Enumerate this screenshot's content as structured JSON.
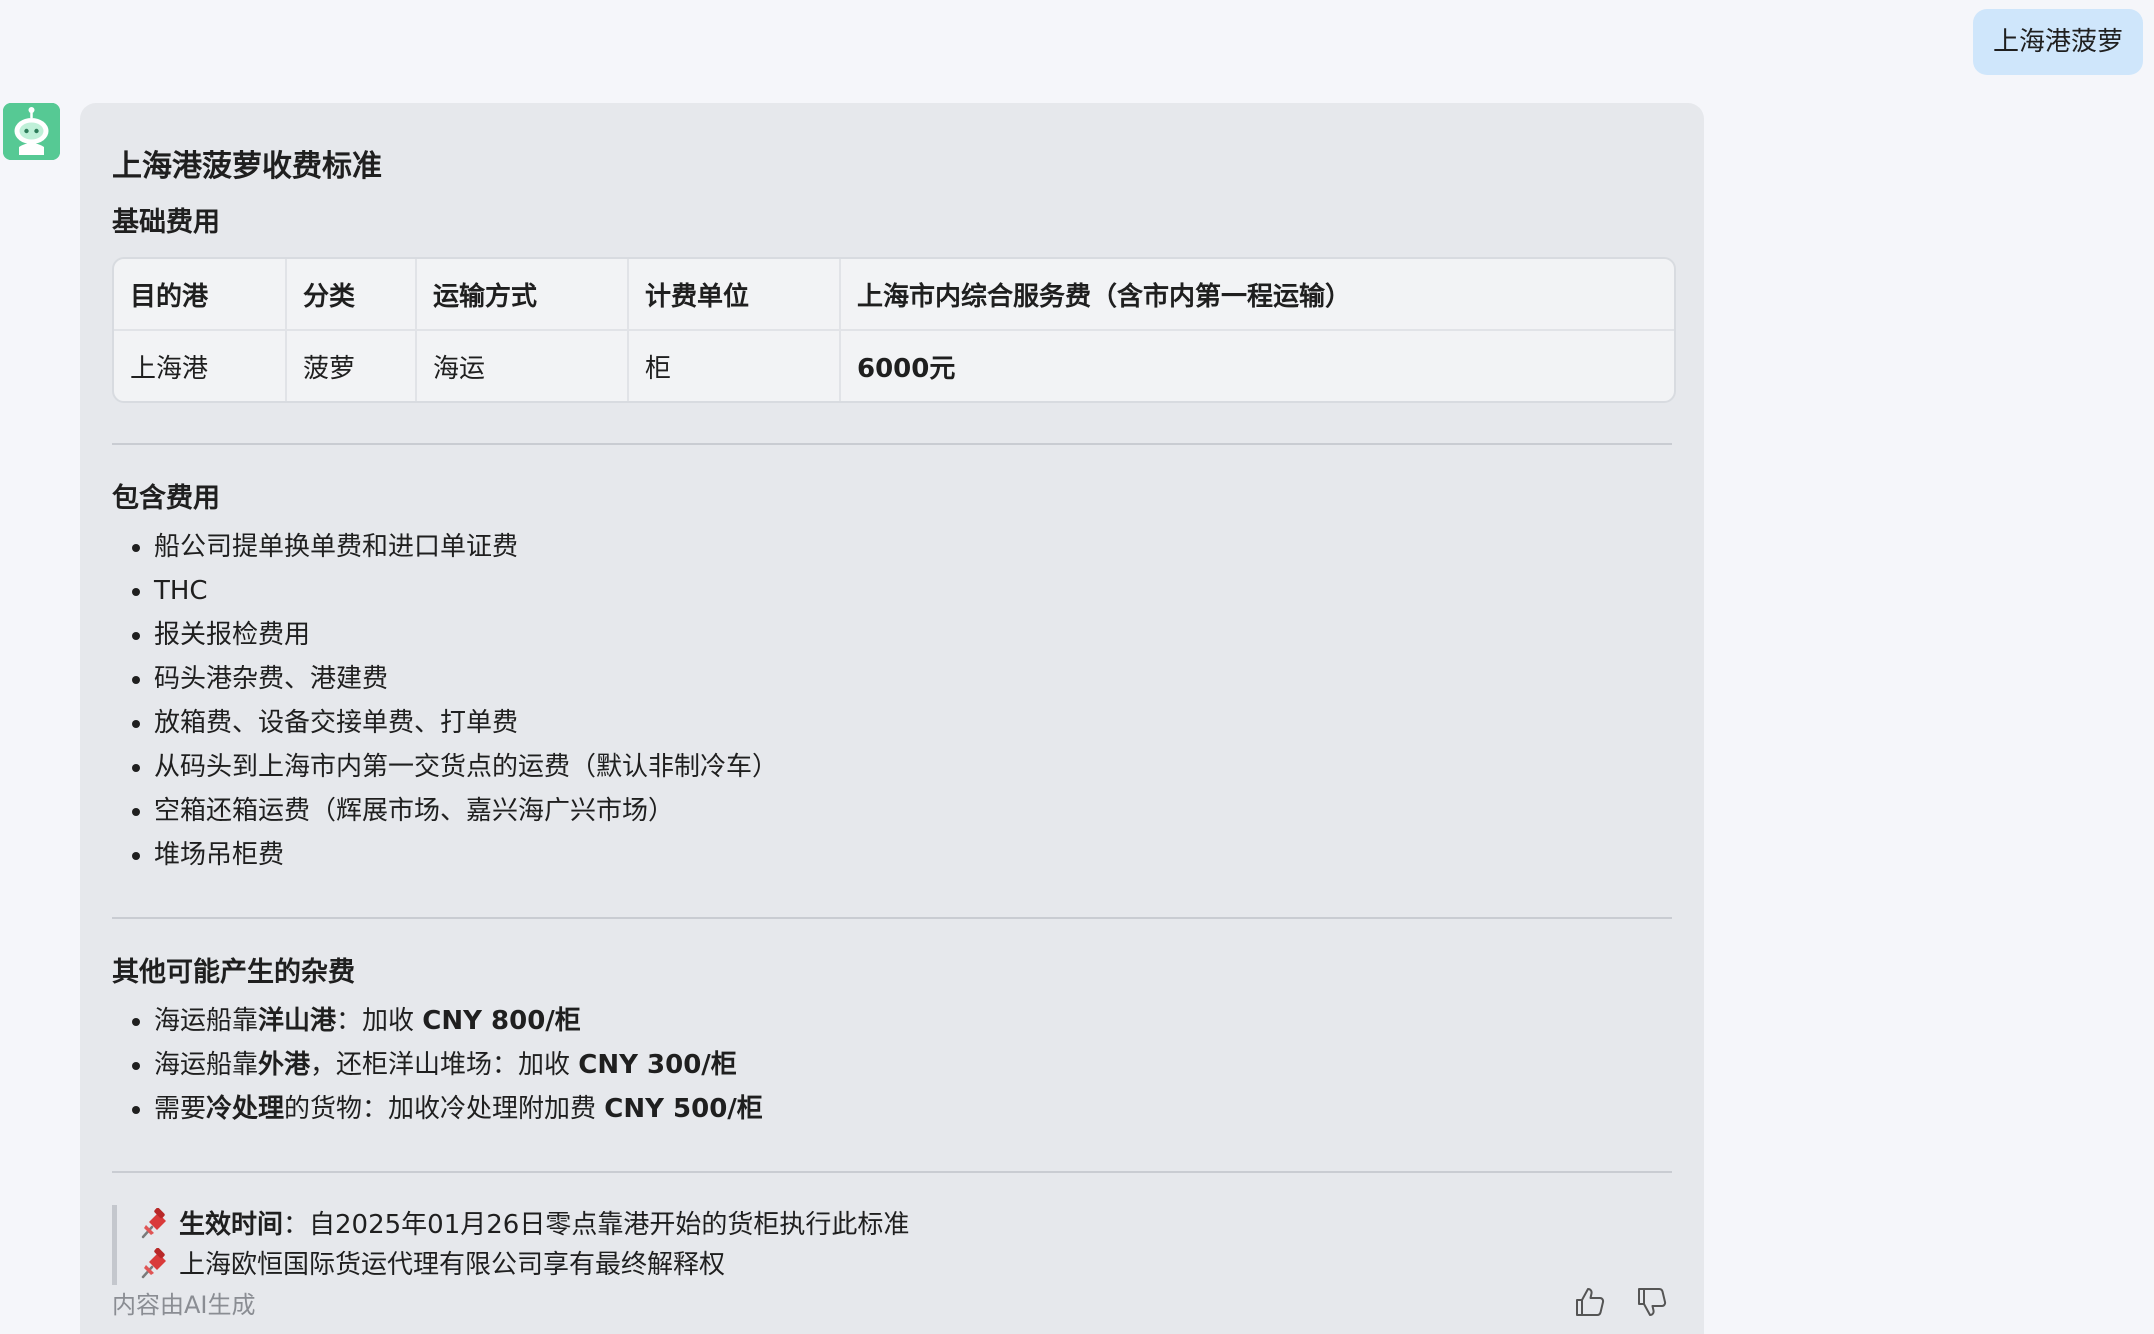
{
  "user_message": "上海港菠萝",
  "assistant": {
    "title": "上海港菠萝收费标准",
    "basic_section": {
      "heading": "基础费用",
      "table": {
        "headers": [
          "目的港",
          "分类",
          "运输方式",
          "计费单位",
          "上海市内综合服务费（含市内第一程运输）"
        ],
        "rows": [
          [
            "上海港",
            "菠萝",
            "海运",
            "柜",
            "6000元"
          ]
        ]
      }
    },
    "included_section": {
      "heading": "包含费用",
      "items": [
        "船公司提单换单费和进口单证费",
        "THC",
        "报关报检费用",
        "码头港杂费、港建费",
        "放箱费、设备交接单费、打单费",
        "从码头到上海市内第一交货点的运费（默认非制冷车）",
        "空箱还箱运费（辉展市场、嘉兴海广兴市场）",
        "堆场吊柜费"
      ]
    },
    "other_section": {
      "heading": "其他可能产生的杂费",
      "items": [
        {
          "pre": "海运船靠",
          "strong": "洋山港",
          "mid": "：加收 ",
          "fee": "CNY 800/柜"
        },
        {
          "pre": "海运船靠",
          "strong": "外港",
          "mid": "，还柜洋山堆场：加收 ",
          "fee": "CNY 300/柜"
        },
        {
          "pre": "需要",
          "strong": "冷处理",
          "mid": "的货物：加收冷处理附加费 ",
          "fee": "CNY 500/柜"
        }
      ]
    },
    "notes": {
      "effective_label": "生效时间",
      "effective_text": "：自2025年01月26日零点靠港开始的货柜执行此标准",
      "rights_text": "上海欧恒国际货运代理有限公司享有最终解释权",
      "icon": "pushpin-icon"
    },
    "footer": {
      "ai_note": "内容由AI生成",
      "like_icon": "thumbs-up-icon",
      "dislike_icon": "thumbs-down-icon"
    }
  },
  "colors": {
    "user_bubble": "#cfe6fb",
    "card_bg": "#e6e8ec",
    "avatar_bg": "#56c994",
    "pin_red": "#d93a3a"
  }
}
